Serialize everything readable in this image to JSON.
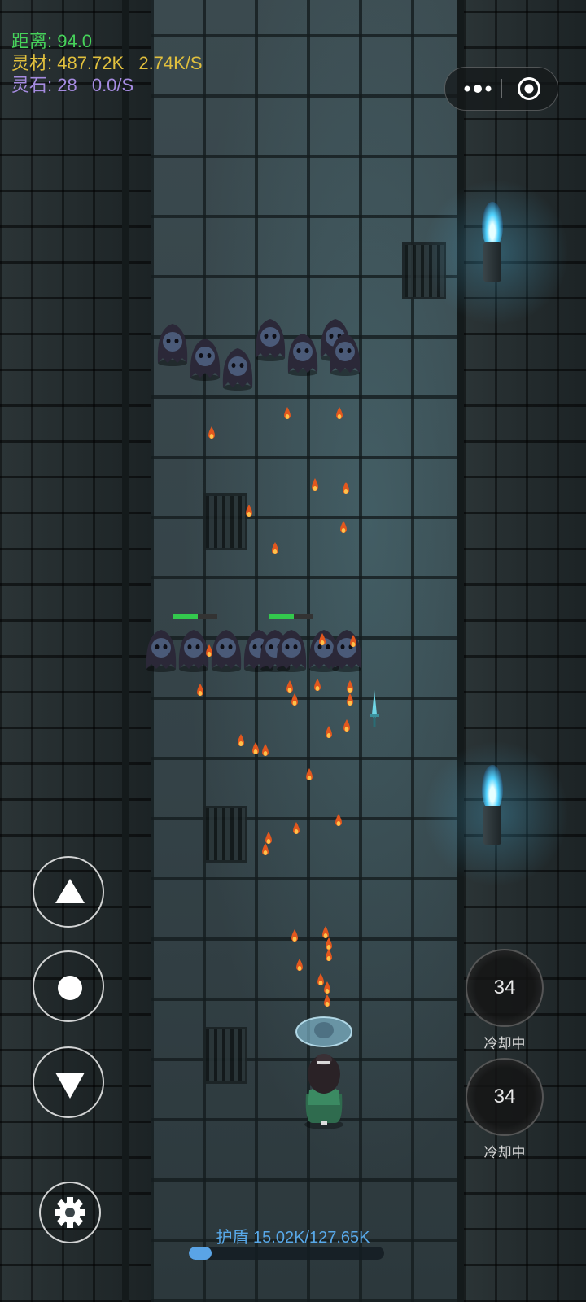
{
  "hud": {
    "distance": "距离: 94.0",
    "material": "灵材: 487.72K",
    "material_rate": "2.74K/S",
    "stone": "灵石: 28",
    "stone_rate": "0.0/S"
  },
  "capsule": {
    "more_icon": "more-dots-icon",
    "close_icon": "target-circle-icon"
  },
  "controls": {
    "up_icon": "triangle-up-icon",
    "center_icon": "circle-dot-icon",
    "down_icon": "triangle-down-icon",
    "settings_icon": "gear-icon"
  },
  "skills": [
    {
      "cooldown": "34",
      "status": "冷却中"
    },
    {
      "cooldown": "34",
      "status": "冷却中"
    }
  ],
  "shield": {
    "label": "护盾 15.02K/127.65K",
    "fraction": 0.118
  },
  "colors": {
    "distance": "#46d35a",
    "material": "#e1c03d",
    "stone": "#a58be0",
    "shield": "#5aa4e6",
    "enemy_hp": "#33c94d"
  },
  "enemy_hp_fraction": 0.55
}
